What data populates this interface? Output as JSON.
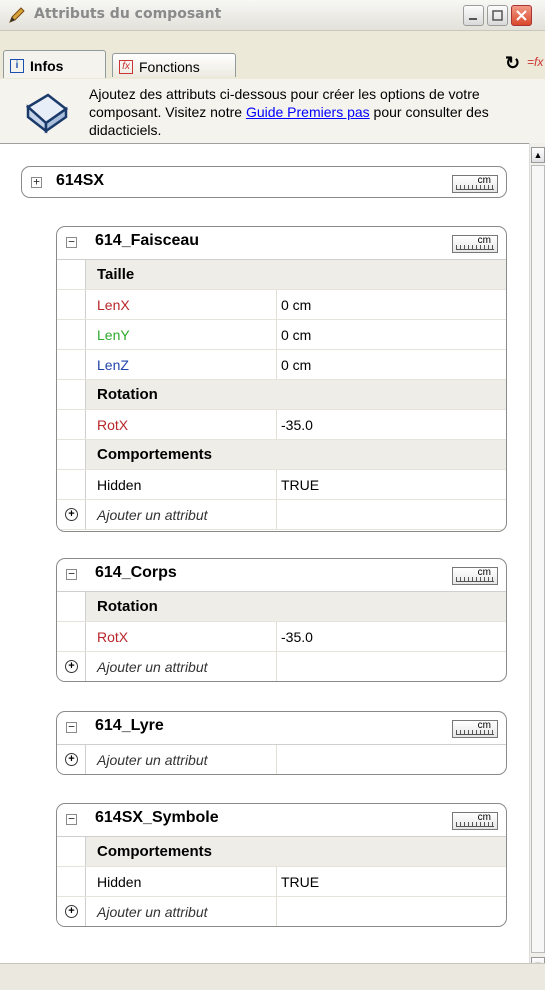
{
  "window": {
    "title": "Attributs du composant"
  },
  "tabs": [
    {
      "label": "Infos"
    },
    {
      "label": "Fonctions"
    }
  ],
  "info": {
    "text_before": "Ajoutez des attributs ci-dessous pour créer les options de votre composant. Visitez notre ",
    "link": "Guide Premiers pas",
    "text_after": " pour consulter des didacticiels."
  },
  "root": {
    "name": "614SX",
    "unit": "cm"
  },
  "faisceau": {
    "name": "614_Faisceau",
    "unit": "cm",
    "section1": "Taille",
    "lenx_k": "LenX",
    "lenx_v": "0 cm",
    "leny_k": "LenY",
    "leny_v": "0 cm",
    "lenz_k": "LenZ",
    "lenz_v": "0 cm",
    "section2": "Rotation",
    "rotx_k": "RotX",
    "rotx_v": "-35.0",
    "section3": "Comportements",
    "hidden_k": "Hidden",
    "hidden_v": "TRUE",
    "add": "Ajouter un attribut"
  },
  "corps": {
    "name": "614_Corps",
    "unit": "cm",
    "section1": "Rotation",
    "rotx_k": "RotX",
    "rotx_v": "-35.0",
    "add": "Ajouter un attribut"
  },
  "lyre": {
    "name": "614_Lyre",
    "unit": "cm",
    "add": "Ajouter un attribut"
  },
  "symbole": {
    "name": "614SX_Symbole",
    "unit": "cm",
    "section1": "Comportements",
    "hidden_k": "Hidden",
    "hidden_v": "TRUE",
    "add": "Ajouter un attribut"
  }
}
